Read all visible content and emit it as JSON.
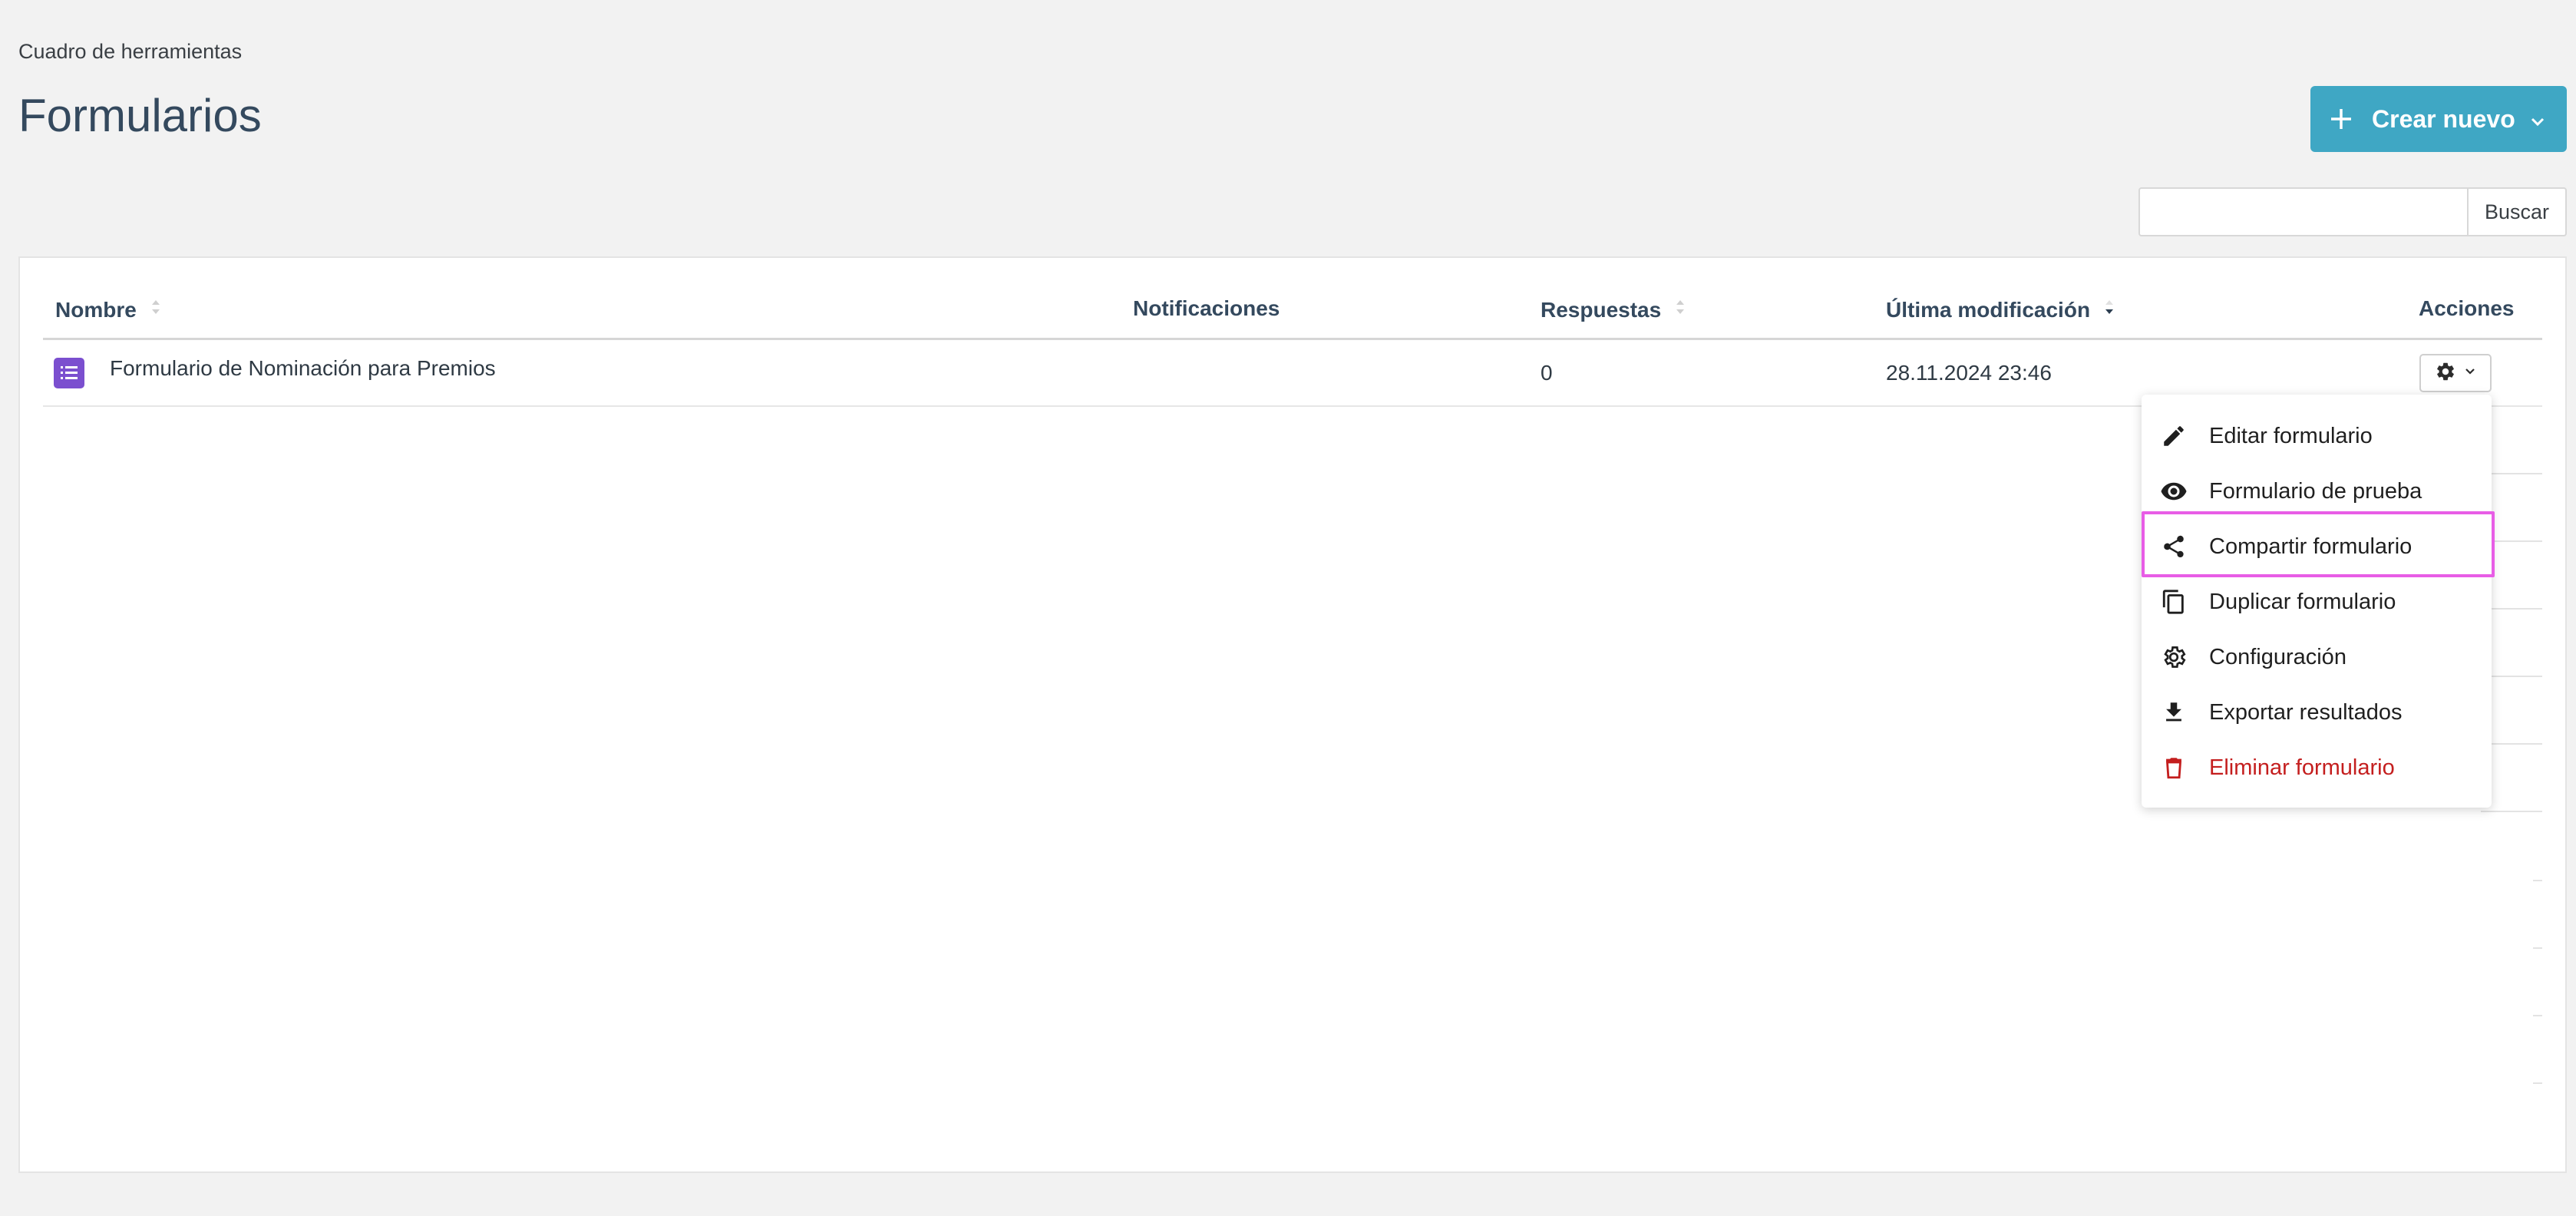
{
  "breadcrumb": "Cuadro de herramientas",
  "page_title": "Formularios",
  "create_button": {
    "label": "Crear nuevo"
  },
  "search": {
    "button_label": "Buscar",
    "value": "",
    "placeholder": ""
  },
  "table": {
    "columns": [
      "Nombre",
      "Notificaciones",
      "Respuestas",
      "Última modificación",
      "Acciones"
    ],
    "rows": [
      {
        "name": "Formulario de Nominación para Premios",
        "notifications": "",
        "responses": "0",
        "modified": "28.11.2024 23:46"
      }
    ]
  },
  "actions_menu": {
    "items": [
      {
        "label": "Editar formulario",
        "icon": "pencil-icon"
      },
      {
        "label": "Formulario de prueba",
        "icon": "eye-icon"
      },
      {
        "label": "Compartir formulario",
        "icon": "share-icon",
        "highlighted": true
      },
      {
        "label": "Duplicar formulario",
        "icon": "copy-icon"
      },
      {
        "label": "Configuración",
        "icon": "gear-icon"
      },
      {
        "label": "Exportar resultados",
        "icon": "download-icon"
      },
      {
        "label": "Eliminar formulario",
        "icon": "trash-icon",
        "danger": true
      }
    ]
  },
  "colors": {
    "accent": "#3fa7c4",
    "form_icon": "#7b4fcf",
    "danger": "#c41e1e",
    "highlight": "#e85de6"
  }
}
